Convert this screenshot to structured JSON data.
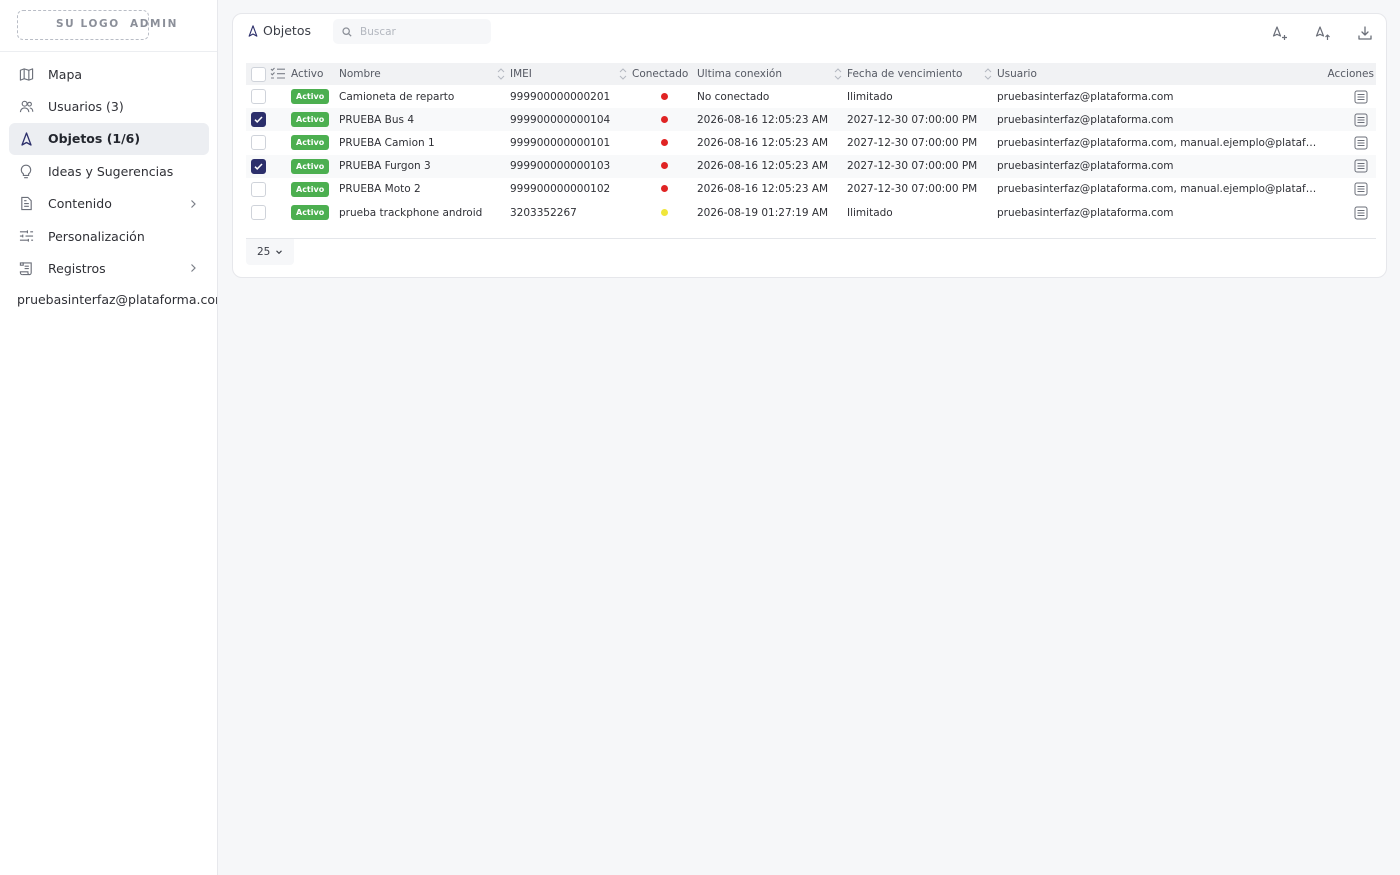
{
  "brand": {
    "logo": "SU LOGO",
    "role": "ADMIN"
  },
  "sidebar": {
    "items": [
      {
        "label": "Mapa",
        "icon": "map-icon"
      },
      {
        "label": "Usuarios (3)",
        "icon": "users-icon"
      },
      {
        "label": "Objetos (1/6)",
        "icon": "navigation-arrow-icon",
        "active": true
      },
      {
        "label": "Ideas y Sugerencias",
        "icon": "lightbulb-icon"
      },
      {
        "label": "Contenido",
        "icon": "document-icon",
        "expandable": true
      },
      {
        "label": "Personalización",
        "icon": "sliders-icon"
      },
      {
        "label": "Registros",
        "icon": "scroll-icon",
        "expandable": true
      }
    ],
    "user": "pruebasinterfaz@plataforma.com (D"
  },
  "header": {
    "title": "Objetos",
    "search_placeholder": "Buscar",
    "tools": [
      "add-object-icon",
      "upload-object-icon",
      "download-icon"
    ]
  },
  "table": {
    "columns": [
      "Activo",
      "Nombre",
      "IMEI",
      "Conectado",
      "Ultima conexión",
      "Fecha de vencimiento",
      "Usuario",
      "Acciones"
    ],
    "rows": [
      {
        "checked": false,
        "status": "Activo",
        "name": "Camioneta de reparto",
        "imei": "999900000000201",
        "connected": "#e02424",
        "last": "No conectado",
        "expiry": "Ilimitado",
        "user": "pruebasinterfaz@plataforma.com"
      },
      {
        "checked": true,
        "status": "Activo",
        "name": "PRUEBA Bus 4",
        "imei": "999900000000104",
        "connected": "#e02424",
        "last": "2026-08-16 12:05:23 AM",
        "expiry": "2027-12-30 07:00:00 PM",
        "user": "pruebasinterfaz@plataforma.com"
      },
      {
        "checked": false,
        "status": "Activo",
        "name": "PRUEBA Camion 1",
        "imei": "999900000000101",
        "connected": "#e02424",
        "last": "2026-08-16 12:05:23 AM",
        "expiry": "2027-12-30 07:00:00 PM",
        "user": "pruebasinterfaz@plataforma.com, manual.ejemplo@plataforma.com"
      },
      {
        "checked": true,
        "status": "Activo",
        "name": "PRUEBA Furgon 3",
        "imei": "999900000000103",
        "connected": "#e02424",
        "last": "2026-08-16 12:05:23 AM",
        "expiry": "2027-12-30 07:00:00 PM",
        "user": "pruebasinterfaz@plataforma.com"
      },
      {
        "checked": false,
        "status": "Activo",
        "name": "PRUEBA Moto 2",
        "imei": "999900000000102",
        "connected": "#e02424",
        "last": "2026-08-16 12:05:23 AM",
        "expiry": "2027-12-30 07:00:00 PM",
        "user": "pruebasinterfaz@plataforma.com, manual.ejemplo@plataforma.com"
      },
      {
        "checked": false,
        "status": "Activo",
        "name": "prueba trackphone android",
        "imei": "3203352267",
        "connected": "#f0e63a",
        "last": "2026-08-19 01:27:19 AM",
        "expiry": "Ilimitado",
        "user": "pruebasinterfaz@plataforma.com"
      }
    ]
  },
  "pager": {
    "page_size": "25"
  },
  "colors": {
    "accent": "#2c2f6b",
    "active_badge": "#4caf50",
    "disconnected": "#e02424",
    "idle": "#f0e63a"
  }
}
